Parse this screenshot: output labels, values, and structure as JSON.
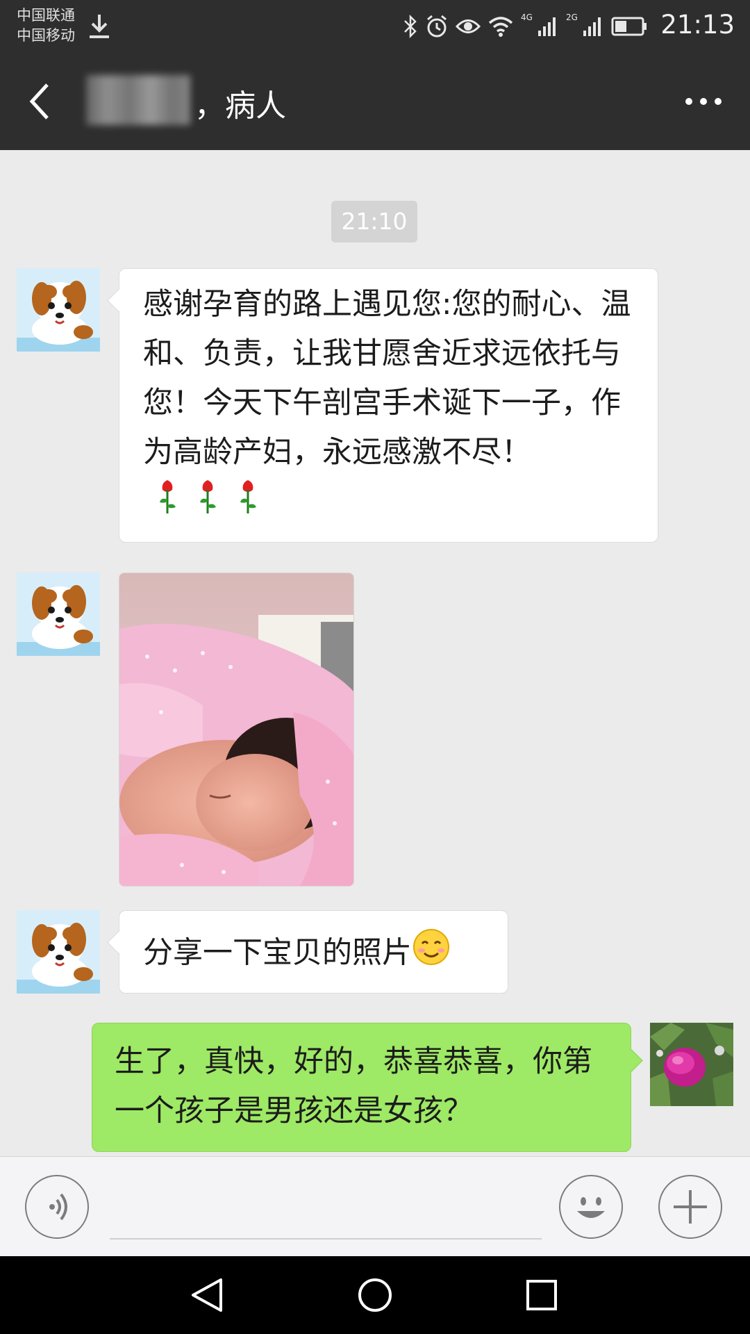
{
  "status_bar": {
    "carrier_1": "中国联通",
    "carrier_2": "中国移动",
    "network_1": "4G",
    "network_2": "2G",
    "time": "21:13",
    "icons": [
      "download-icon",
      "bluetooth-icon",
      "alarm-icon",
      "eye-icon",
      "wifi-icon",
      "signal-icon",
      "battery-icon"
    ]
  },
  "header": {
    "title": "，病人",
    "back_icon": "back-icon",
    "more_icon": "more-icon"
  },
  "chat": {
    "timestamp": "21:10",
    "messages": [
      {
        "from": "other",
        "type": "text",
        "text": "感谢孕育的路上遇见您:您的耐心、温和、负责，让我甘愿舍近求远依托与您！今天下午剖宫手术诞下一子，作为高龄产妇，永远感激不尽！"
      },
      {
        "from": "other",
        "type": "image",
        "image": "newborn-baby-photo"
      },
      {
        "from": "other",
        "type": "text",
        "text": "分享一下宝贝的照片"
      },
      {
        "from": "me",
        "type": "text",
        "text": "生了，真快，好的，恭喜恭喜，你第一个孩子是男孩还是女孩？"
      }
    ]
  },
  "input_bar": {
    "icons": [
      "voice-icon",
      "emoji-icon",
      "plus-icon"
    ]
  },
  "nav_bar": {
    "icons": [
      "nav-back-icon",
      "nav-home-icon",
      "nav-recents-icon"
    ]
  },
  "colors": {
    "header_bg": "#2e2e2e",
    "chat_bg": "#ebebeb",
    "bubble_other": "#ffffff",
    "bubble_me": "#9ee965",
    "timestamp_bg": "#d4d4d4"
  }
}
